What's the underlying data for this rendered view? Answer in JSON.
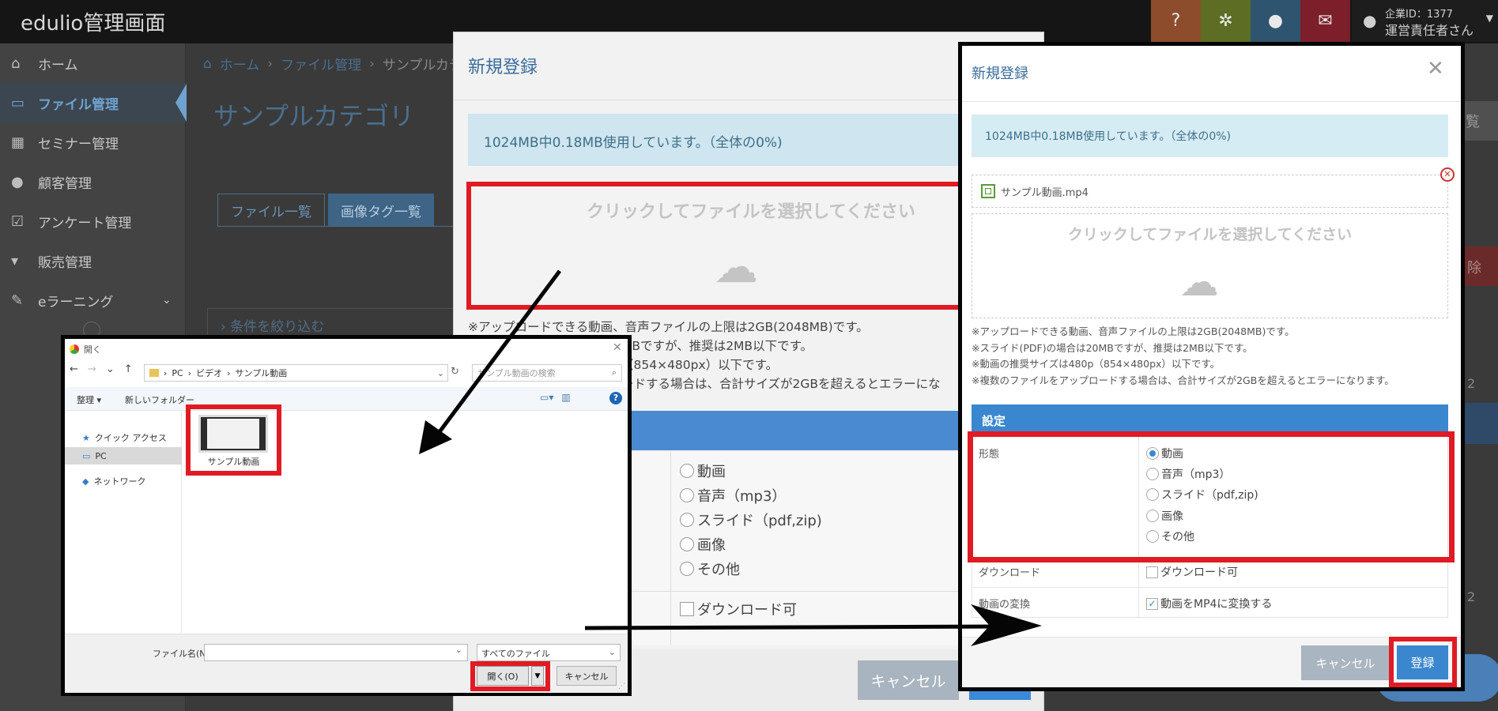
{
  "app": {
    "title": "edulio管理画面",
    "account_id": "企業ID：1377",
    "account_name": "運営責任者さん",
    "topbar_icons": [
      "help-icon",
      "gear-icon",
      "user-icon",
      "mail-icon"
    ]
  },
  "sidebar": {
    "items": [
      {
        "label": "ホーム",
        "icon": "home-icon"
      },
      {
        "label": "ファイル管理",
        "icon": "folder-icon",
        "active": true
      },
      {
        "label": "セミナー管理",
        "icon": "calendar-icon"
      },
      {
        "label": "顧客管理",
        "icon": "users-icon"
      },
      {
        "label": "アンケート管理",
        "icon": "checkbox-icon"
      },
      {
        "label": "販売管理",
        "icon": "cart-icon"
      },
      {
        "label": "eラーニング",
        "icon": "pencil-icon"
      }
    ]
  },
  "page": {
    "breadcrumb": [
      "ホーム",
      "ファイル管理",
      "サンプルカテ"
    ],
    "title": "サンプルカテゴリ",
    "tabs": [
      "ファイル一覧",
      "画像タグ一覧"
    ],
    "filter_label": "条件を絞り込む",
    "right_button_1": "覧",
    "right_button_2": "除",
    "right_num_1": "2",
    "right_num_2": "2"
  },
  "modal_back": {
    "title": "新規登録",
    "usage": "1024MB中0.18MB使用しています。（全体の0%)",
    "drop_text": "クリックしてファイルを選択してください",
    "notes": [
      "※アップロードできる動画、音声ファイルの上限は2GB(2048MB)です。",
      "MBですが、推奨は2MB以下です。",
      "（854×480px）以下です。",
      "ードする場合は、合計サイズが2GBを超えるとエラーにな"
    ],
    "format_options": [
      "動画",
      "音声（mp3）",
      "スライド（pdf,zip)",
      "画像",
      "その他"
    ],
    "download_label": "ダウンロード可",
    "cancel_label": "キャンセル"
  },
  "file_dialog": {
    "title": "開く",
    "path": [
      "PC",
      "ビデオ",
      "サンプル動画"
    ],
    "search_placeholder": "サンプル動画の検索",
    "organize_label": "整理 ▾",
    "new_folder_label": "新しいフォルダー",
    "nav_items": [
      "クイック アクセス",
      "PC",
      "ネットワーク"
    ],
    "file_name": "サンプル動画",
    "filename_label": "ファイル名(N):",
    "file_type": "すべてのファイル",
    "open_label": "開く(O)",
    "cancel_label": "キャンセル"
  },
  "modal_front": {
    "title": "新規登録",
    "usage": "1024MB中0.18MB使用しています。（全体の0%)",
    "selected_file": "サンプル動画.mp4",
    "drop_text": "クリックしてファイルを選択してください",
    "notes": [
      "※アップロードできる動画、音声ファイルの上限は2GB(2048MB)です。",
      "※スライド(PDF)の場合は20MBですが、推奨は2MB以下です。",
      "※動画の推奨サイズは480p（854×480px）以下です。",
      "※複数のファイルをアップロードする場合は、合計サイズが2GBを超えるとエラーになります。"
    ],
    "settings_header": "設定",
    "format_label": "形態",
    "format_options": [
      "動画",
      "音声（mp3）",
      "スライド（pdf,zip)",
      "画像",
      "その他"
    ],
    "format_selected": "動画",
    "download_row_label": "ダウンロード",
    "download_option": "ダウンロード可",
    "convert_row_label": "動画の変換",
    "convert_option": "動画をMP4に変換する",
    "convert_checked": true,
    "cancel_label": "キャンセル",
    "register_label": "登録"
  },
  "colors": {
    "accent": "#3a87cf",
    "highlight": "#e01b24"
  }
}
